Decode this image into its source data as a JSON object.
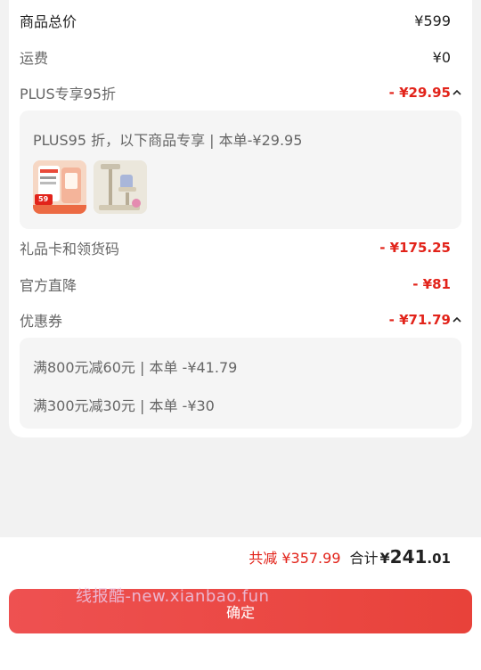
{
  "summary": {
    "goods_total_label": "商品总价",
    "goods_total_value": "¥599",
    "shipping_label": "运费",
    "shipping_value": "¥0",
    "plus_label": "PLUS专享95折",
    "plus_value": "- ¥29.95",
    "plus_detail": "PLUS95 折，以下商品专享 | 本单-¥29.95",
    "giftcard_label": "礼品卡和领货码",
    "giftcard_value": "- ¥175.25",
    "direct_label": "官方直降",
    "direct_value": "- ¥81",
    "coupon_label": "优惠券",
    "coupon_value": "- ¥71.79",
    "coupons": [
      "满800元减60元 | 本单 -¥41.79",
      "满300元减30元 | 本单 -¥30"
    ],
    "thumb1_badge": "59"
  },
  "footer": {
    "reduce_text": "共减 ¥357.99",
    "sum_label": "合计",
    "sum_currency": "¥",
    "sum_int": "241",
    "sum_dec": ".01",
    "confirm_label": "确定",
    "watermark": "线报酷-new.xianbao.fun"
  },
  "colors": {
    "accent": "#e2231a",
    "button": "#e8423a"
  }
}
